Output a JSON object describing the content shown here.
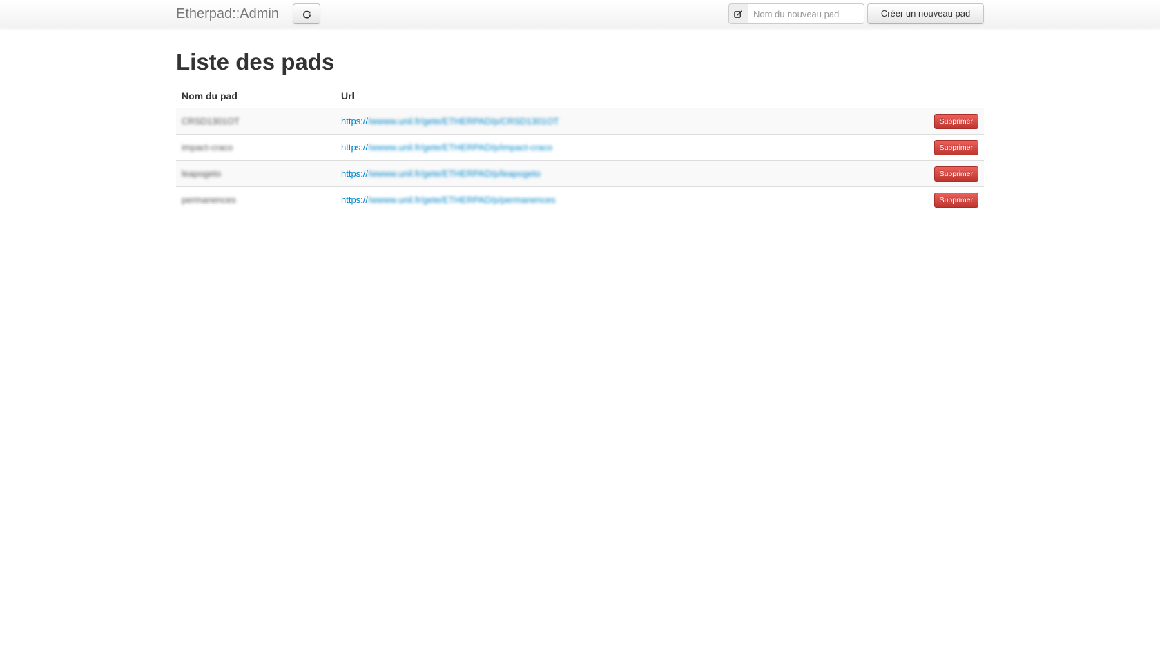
{
  "navbar": {
    "brand": "Etherpad::Admin",
    "refresh_icon": "refresh-icon",
    "edit_icon": "edit-icon",
    "new_pad_placeholder": "Nom du nouveau pad",
    "create_button_label": "Créer un nouveau pad"
  },
  "main": {
    "title": "Liste des pads",
    "table": {
      "headers": {
        "name": "Nom du pad",
        "url": "Url"
      },
      "rows": [
        {
          "name": "CRSD1301OT",
          "url_prefix": "https://",
          "url_rest": "/wwww.unil.fr/gete/ETHERPAD/p/CRSD1301OT",
          "delete_label": "Supprimer"
        },
        {
          "name": "impact-craco",
          "url_prefix": "https://",
          "url_rest": "/wwww.unil.fr/gete/ETHERPAD/p/impact-craco",
          "delete_label": "Supprimer"
        },
        {
          "name": "leapogeto",
          "url_prefix": "https://",
          "url_rest": "/wwww.unil.fr/gete/ETHERPAD/p/leapogeto",
          "delete_label": "Supprimer"
        },
        {
          "name": "permanences",
          "url_prefix": "https://",
          "url_rest": "/wwww.unil.fr/gete/ETHERPAD/p/permanences",
          "delete_label": "Supprimer"
        }
      ]
    }
  },
  "colors": {
    "link": "#0088cc",
    "danger": "#da4f49",
    "navbar_bg": "#f2f2f2"
  }
}
